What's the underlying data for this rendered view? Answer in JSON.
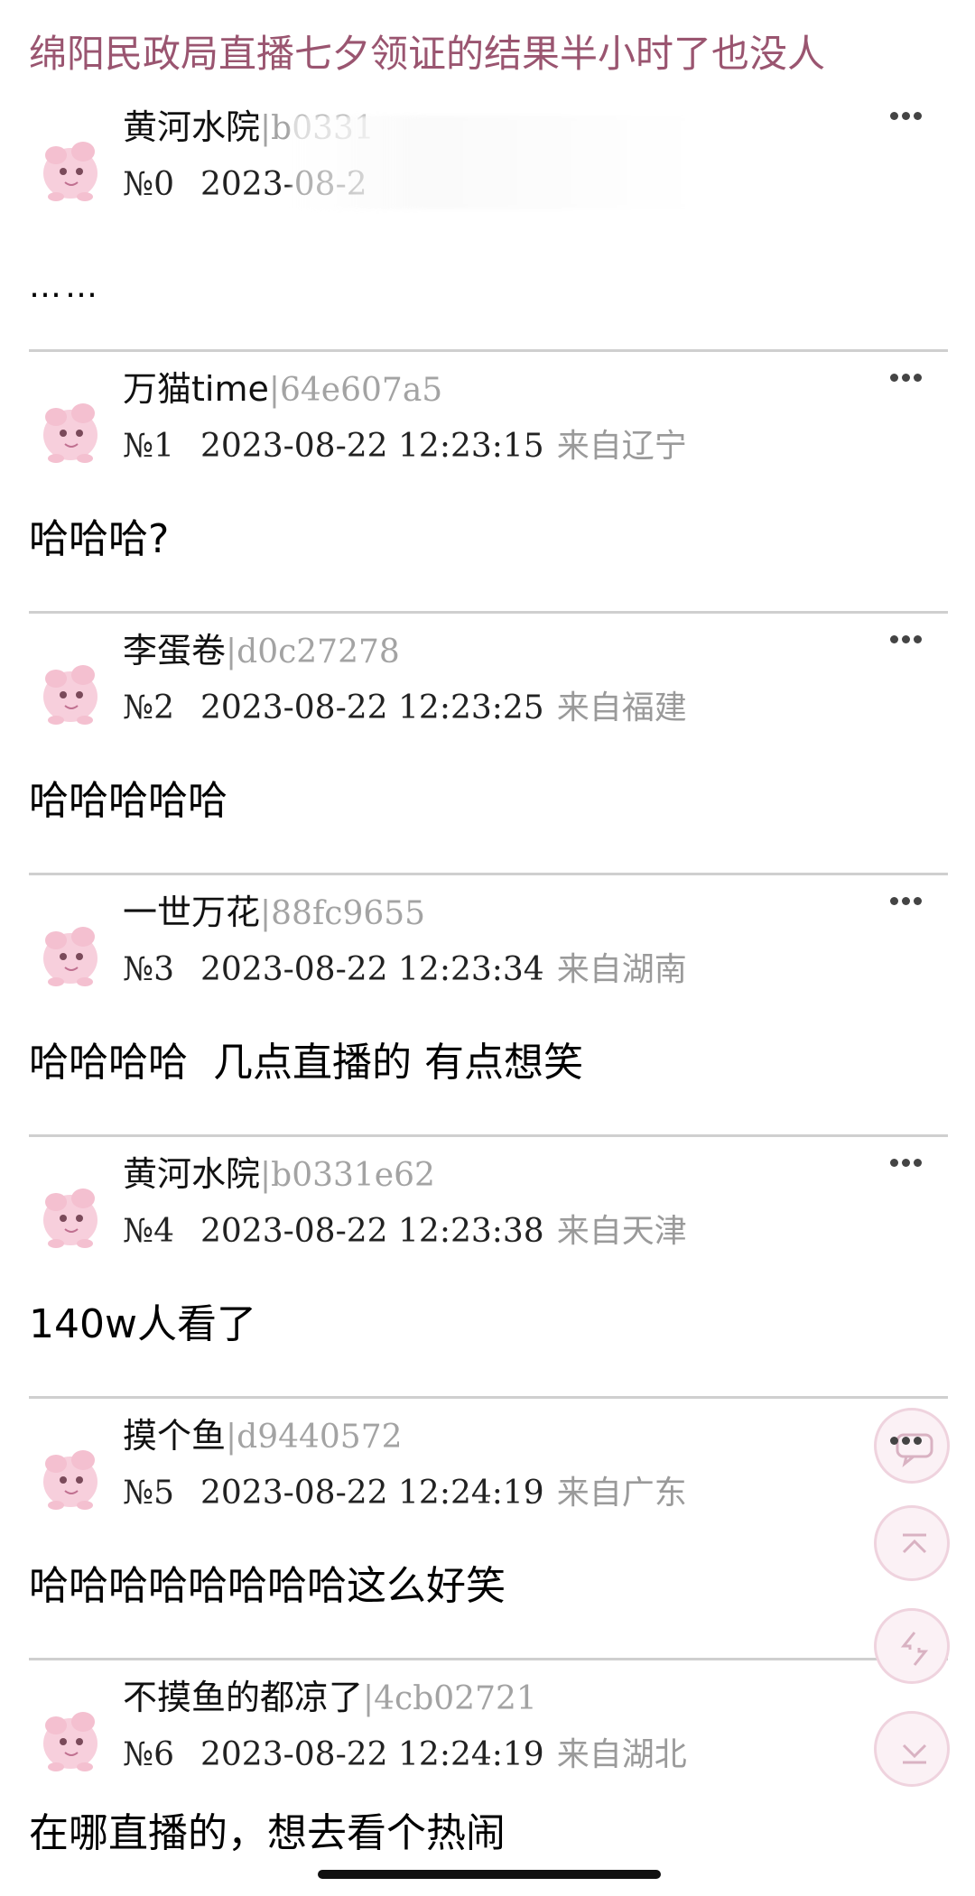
{
  "thread": {
    "title": "绵阳民政局直播七夕领证的结果半小时了也没人"
  },
  "posts": [
    {
      "name": "黄河水院",
      "uid": "|b0331",
      "no": "№0",
      "time": "2023-08-2",
      "location": "",
      "content": "……"
    },
    {
      "name": "万猫time",
      "uid": "|64e607a5",
      "no": "№1",
      "time": "2023-08-22 12:23:15",
      "location": "来自辽宁",
      "content": "哈哈哈?"
    },
    {
      "name": "李蛋卷",
      "uid": "|d0c27278",
      "no": "№2",
      "time": "2023-08-22 12:23:25",
      "location": "来自福建",
      "content": "哈哈哈哈哈"
    },
    {
      "name": "一世万花",
      "uid": "|88fc9655",
      "no": "№3",
      "time": "2023-08-22 12:23:34",
      "location": "来自湖南",
      "content": "哈哈哈哈  几点直播的 有点想笑"
    },
    {
      "name": "黄河水院",
      "uid": "|b0331e62",
      "no": "№4",
      "time": "2023-08-22 12:23:38",
      "location": "来自天津",
      "content": "140w人看了"
    },
    {
      "name": "摸个鱼",
      "uid": "|d9440572",
      "no": "№5",
      "time": "2023-08-22 12:24:19",
      "location": "来自广东",
      "content": "哈哈哈哈哈哈哈哈这么好笑"
    },
    {
      "name": "不摸鱼的都凉了",
      "uid": "|4cb02721",
      "no": "№6",
      "time": "2023-08-22 12:24:19",
      "location": "来自湖北",
      "content": "在哪直播的，想去看个热闹"
    }
  ],
  "icons": {
    "avatar": "pink-creature-avatar-icon",
    "more": "more-dots-icon",
    "reply": "comment-bubble-icon",
    "top": "scroll-top-icon",
    "refresh": "refresh-icon",
    "bottom": "scroll-bottom-icon"
  },
  "colors": {
    "title": "#9a5570",
    "accent": "#efd3de",
    "muted": "#9a9a9a"
  }
}
